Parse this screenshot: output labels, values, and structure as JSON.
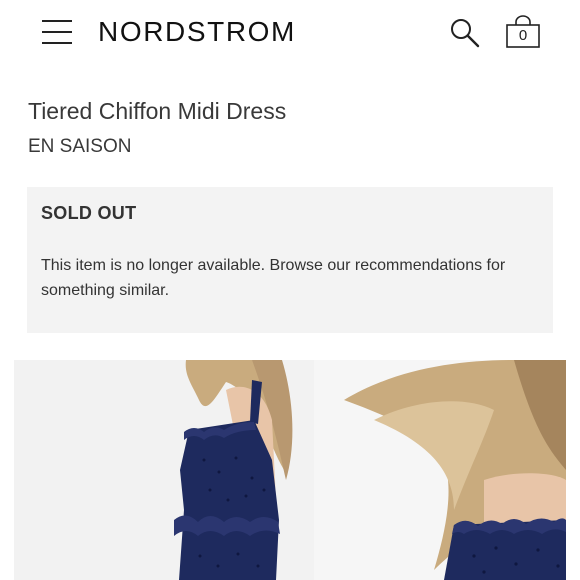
{
  "header": {
    "logo": "NORDSTROM",
    "bag_count": "0",
    "icons": {
      "menu": "hamburger-menu-icon",
      "search": "search-icon",
      "bag": "shopping-bag-icon"
    }
  },
  "product": {
    "title": "Tiered Chiffon Midi Dress",
    "brand": "EN SAISON"
  },
  "availability": {
    "heading": "SOLD OUT",
    "message": "This item is no longer available. Browse our recommendations for something similar."
  },
  "colors": {
    "dress_navy": "#1e2a5e",
    "panel_gray": "#f3f3f3",
    "hair_blonde": "#c9ab7e"
  }
}
